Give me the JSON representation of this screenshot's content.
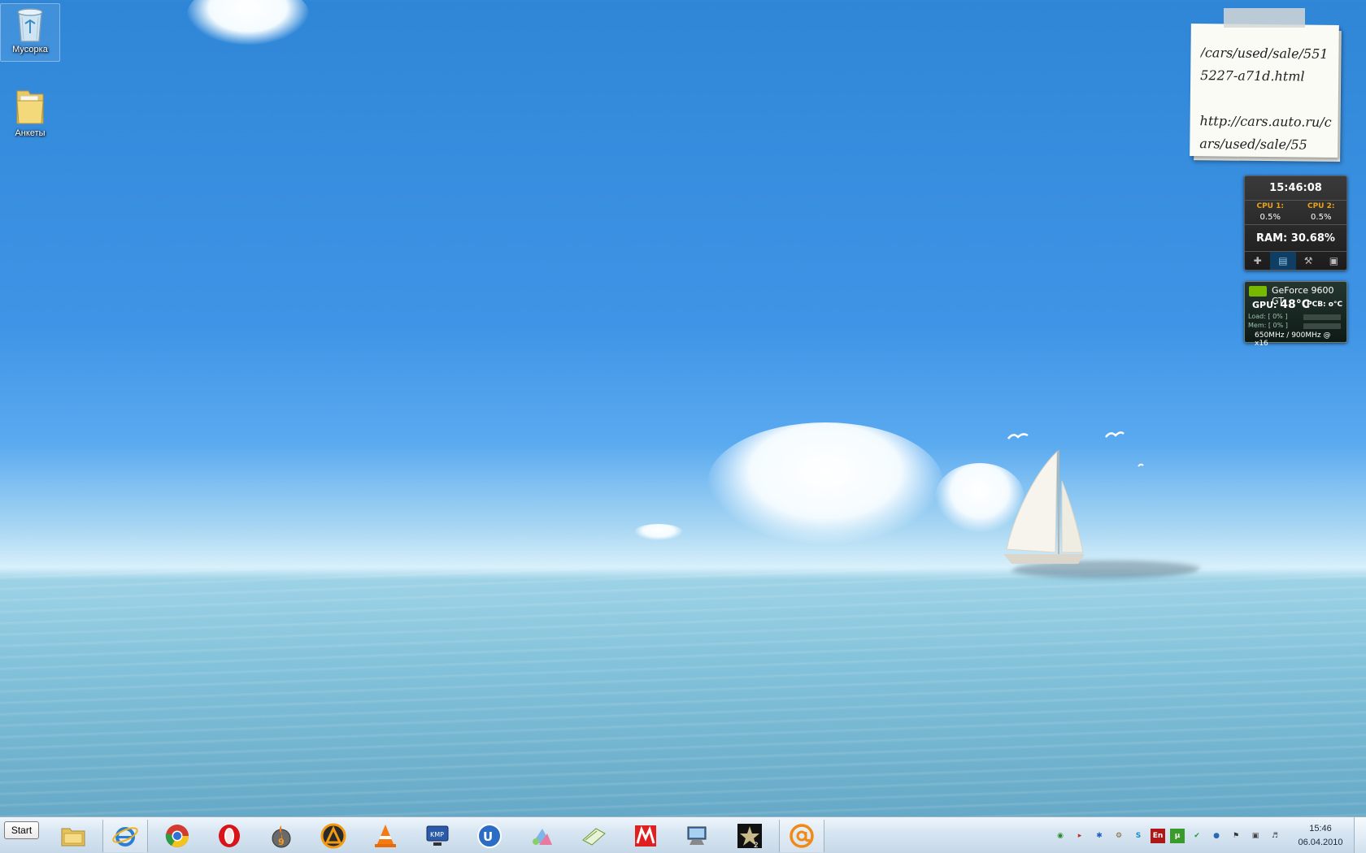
{
  "desktop": {
    "icons": [
      {
        "label": "Мусорка",
        "icon": "recycle-bin-icon"
      },
      {
        "label": "Анкеты",
        "icon": "folder-icon"
      }
    ]
  },
  "sticky_note": {
    "text": "/cars/used/sale/5515227-a71d.html\n\nhttp://cars.auto.ru/cars/used/sale/55"
  },
  "cpu_gadget": {
    "time": "15:46:08",
    "cpu1_label": "CPU 1:",
    "cpu1_value": "0.5%",
    "cpu2_label": "CPU 2:",
    "cpu2_value": "0.5%",
    "ram": "RAM: 30.68%",
    "toolbar_icons": [
      "plus-icon",
      "graph-icon",
      "wrench-icon",
      "lock-icon"
    ]
  },
  "gpu_gadget": {
    "name": "GeForce 9600 GT",
    "gpu_label": "GPU:",
    "gpu_temp": "48°C",
    "pcb": "PCB: o°C",
    "load": "Load: [ 0% ]",
    "mem": "Mem: [ 0% ]",
    "clocks": "650MHz / 900MHz @ x16",
    "accent": "#76b900"
  },
  "taskbar": {
    "start_label": "Start",
    "pinned": [
      {
        "name": "explorer",
        "icon": "folder-icon",
        "running": false
      },
      {
        "name": "internet-explorer",
        "icon": "ie-icon",
        "running": true
      },
      {
        "name": "chrome",
        "icon": "chrome-icon",
        "running": false
      },
      {
        "name": "opera",
        "icon": "opera-icon",
        "running": false
      },
      {
        "name": "burner",
        "icon": "burner-icon",
        "running": false
      },
      {
        "name": "aimp",
        "icon": "aimp-icon",
        "running": false
      },
      {
        "name": "vlc",
        "icon": "vlc-icon",
        "running": false
      },
      {
        "name": "kmplayer",
        "icon": "kmplayer-icon",
        "running": false
      },
      {
        "name": "uc-browser",
        "icon": "u-icon",
        "running": false
      },
      {
        "name": "paint-tool",
        "icon": "paint-icon",
        "running": false
      },
      {
        "name": "notes",
        "icon": "notebook-icon",
        "running": false
      },
      {
        "name": "metro",
        "icon": "metro-icon",
        "running": false
      },
      {
        "name": "network-computer",
        "icon": "monitor-icon",
        "running": false
      },
      {
        "name": "star2",
        "icon": "star-icon",
        "running": false
      },
      {
        "name": "mail-agent",
        "icon": "at-icon",
        "running": true
      }
    ],
    "tray": [
      {
        "icon": "eye-icon",
        "text": ""
      },
      {
        "icon": "speaker-red-icon",
        "text": ""
      },
      {
        "icon": "lightning-icon",
        "text": ""
      },
      {
        "icon": "gear-icon",
        "text": ""
      },
      {
        "icon": "skype-icon",
        "text": ""
      },
      {
        "icon": "language-icon",
        "text": "En"
      },
      {
        "icon": "utorrent-icon",
        "text": "µ"
      },
      {
        "icon": "check-icon",
        "text": ""
      },
      {
        "icon": "globe-icon",
        "text": ""
      },
      {
        "icon": "flag-icon",
        "text": ""
      },
      {
        "icon": "network-icon",
        "text": ""
      },
      {
        "icon": "volume-icon",
        "text": ""
      }
    ],
    "clock_time": "15:46",
    "clock_date": "06.04.2010"
  }
}
